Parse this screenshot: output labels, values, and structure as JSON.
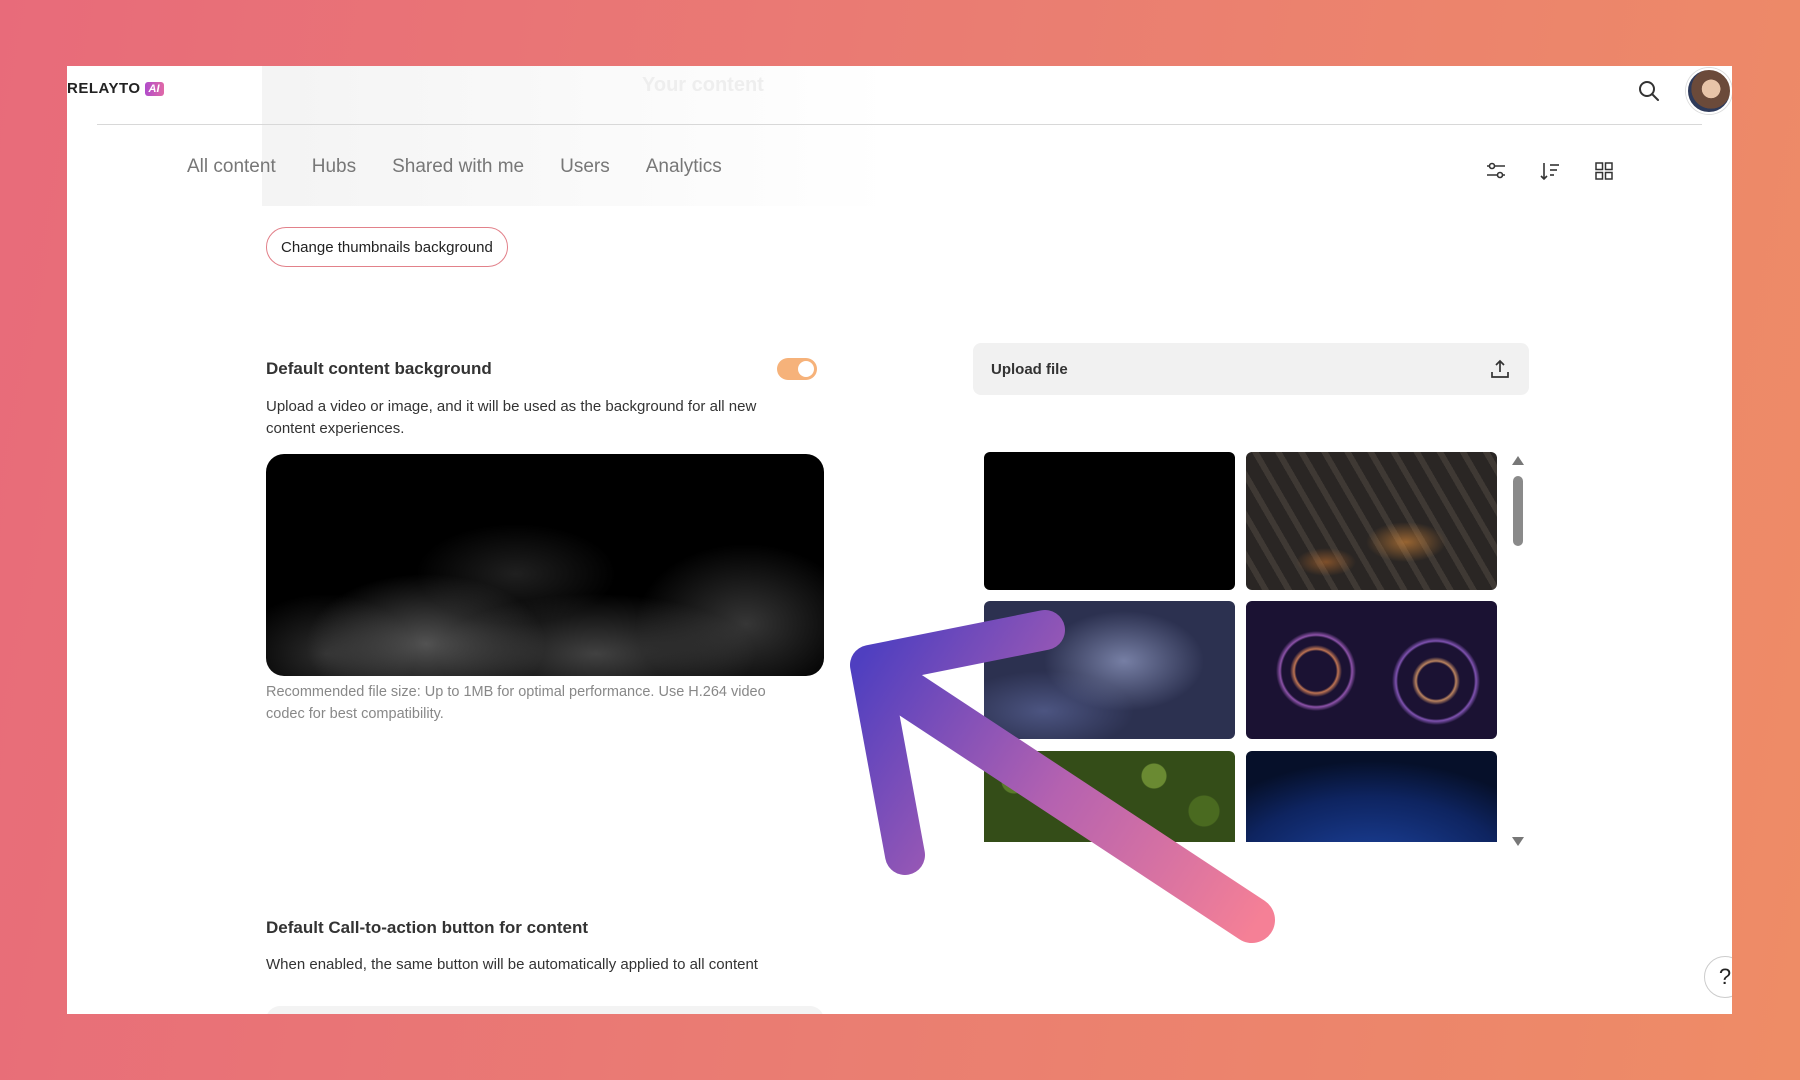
{
  "header": {
    "logo_text": "RELAYTO",
    "logo_badge": "AI",
    "ghost_text": "Your content"
  },
  "nav": {
    "items": [
      "All content",
      "Hubs",
      "Shared with me",
      "Users",
      "Analytics"
    ]
  },
  "thumbnails_button": "Change thumbnails background",
  "content_background": {
    "title": "Default content background",
    "description": "Upload a video or image, and it will be used as the background for all new content experiences.",
    "toggle_on": true,
    "hint": "Recommended file size: Up to 1MB for optimal performance. Use H.264 video codec for best compatibility."
  },
  "upload": {
    "label": "Upload file"
  },
  "cta": {
    "title": "Default Call-to-action button for content",
    "description": "When enabled, the same button will be automatically applied to all content"
  },
  "help": {
    "label": "?"
  },
  "colors": {
    "accent_toggle": "#f6b27a",
    "pill_border": "#e2818a",
    "arrow_start": "#4f3fc0",
    "arrow_end": "#f58096"
  },
  "icons": [
    "search-icon",
    "filter-icon",
    "sort-icon",
    "grid-view-icon",
    "upload-icon",
    "help-icon"
  ]
}
